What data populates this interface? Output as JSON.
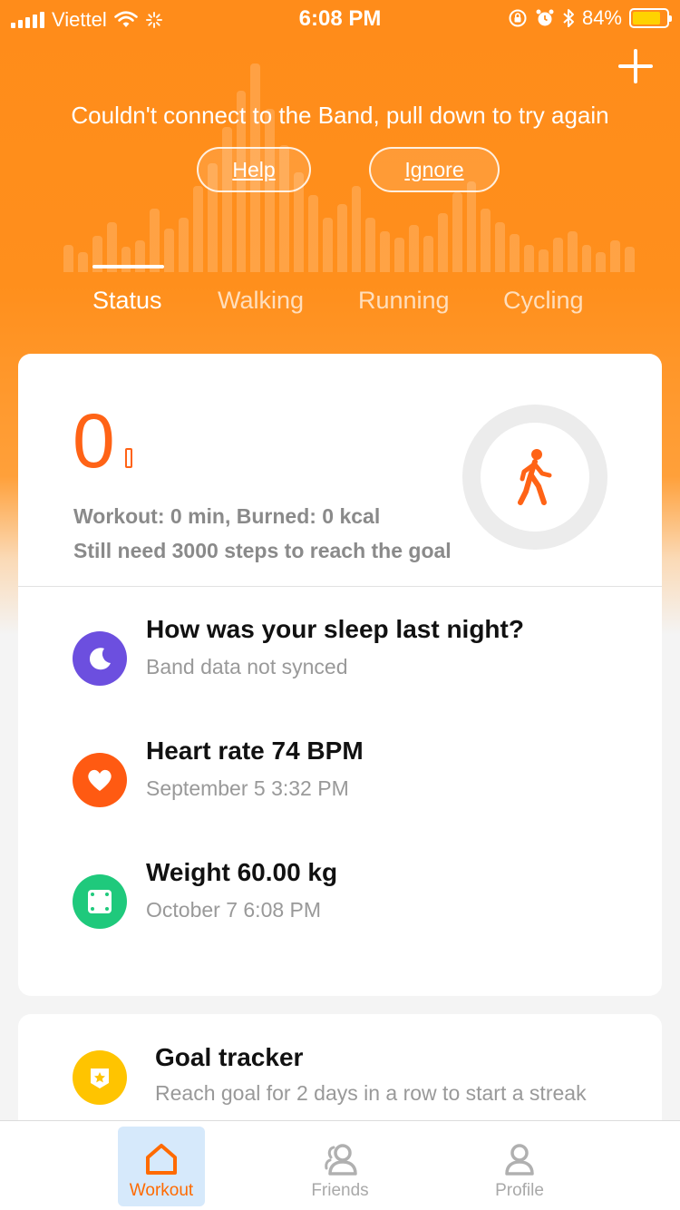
{
  "status_bar": {
    "carrier": "Viettel",
    "time": "6:08 PM",
    "battery_percent": "84%",
    "battery_level": 0.84,
    "icons": [
      "signal-icon",
      "wifi-icon",
      "activity-spinner-icon",
      "rotation-lock-icon",
      "alarm-icon",
      "bluetooth-icon",
      "battery-icon"
    ]
  },
  "header": {
    "add_icon": "plus-icon",
    "connection_message": "Couldn't connect to the Band, pull down to try again",
    "help_label": "Help",
    "ignore_label": "Ignore"
  },
  "tabs": [
    {
      "label": "Status",
      "active": true
    },
    {
      "label": "Walking",
      "active": false
    },
    {
      "label": "Running",
      "active": false
    },
    {
      "label": "Cycling",
      "active": false
    }
  ],
  "summary": {
    "steps": "0",
    "workout_text": "Workout: 0 min, Burned: 0 kcal",
    "goal_text": "Still need 3000 steps to reach the goal",
    "progress_fraction": 0,
    "ring_icon": "walking-person-icon"
  },
  "items": [
    {
      "title": "How was your sleep last night?",
      "subtitle": "Band data not synced",
      "icon": "sleep-moon-icon",
      "color": "#6c4fdf"
    },
    {
      "title": "Heart rate 74 BPM",
      "subtitle": "September 5 3:32 PM",
      "icon": "heart-icon",
      "color": "#ff5a12"
    },
    {
      "title": "Weight 60.00 kg",
      "subtitle": "October 7 6:08 PM",
      "icon": "scale-icon",
      "color": "#1fc97c"
    }
  ],
  "goal_tracker": {
    "title": "Goal tracker",
    "subtitle": "Reach goal for 2 days in a row to start a streak",
    "icon": "badge-star-icon",
    "color": "#ffc400"
  },
  "bottom_nav": [
    {
      "label": "Workout",
      "icon": "home-icon",
      "active": true
    },
    {
      "label": "Friends",
      "icon": "friends-icon",
      "active": false
    },
    {
      "label": "Profile",
      "icon": "profile-icon",
      "active": false
    }
  ],
  "colors": {
    "accent": "#ff6316",
    "header_orange": "#ff8c1a",
    "active_nav_bg": "#d6e9fb"
  }
}
